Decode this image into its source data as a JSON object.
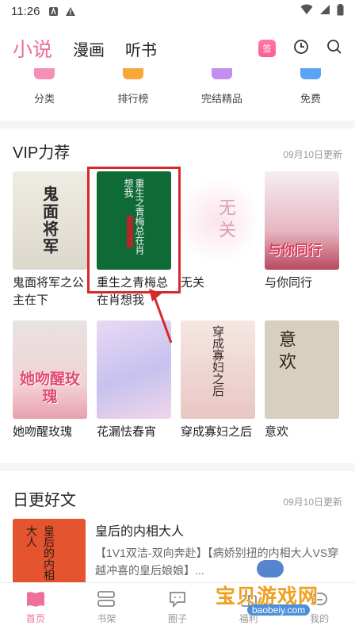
{
  "status": {
    "time": "11:26"
  },
  "nav": {
    "tabs": [
      {
        "label": "小说"
      },
      {
        "label": "漫画"
      },
      {
        "label": "听书"
      }
    ],
    "sign_label": "签"
  },
  "categories": [
    {
      "label": "分类"
    },
    {
      "label": "排行榜"
    },
    {
      "label": "完结精品"
    },
    {
      "label": "免费"
    }
  ],
  "vip": {
    "title": "VIP力荐",
    "updated": "09月10日更新",
    "books": [
      {
        "name": "鬼面将军之公主在下",
        "cover_text": "鬼面将军"
      },
      {
        "name": "重生之青梅总在肖想我",
        "cover_text": "重生之青梅总在肖想我"
      },
      {
        "name": "无关",
        "cover_text": "无关"
      },
      {
        "name": "与你同行",
        "cover_text": "与你同行"
      },
      {
        "name": "她吻醒玫瑰",
        "cover_text": "她吻醒玫瑰"
      },
      {
        "name": "花漏怯春宵",
        "cover_text": ""
      },
      {
        "name": "穿成寡妇之后",
        "cover_text": "穿成寡妇之后"
      },
      {
        "name": "意欢",
        "cover_text": "意欢"
      }
    ]
  },
  "daily": {
    "title": "日更好文",
    "updated": "09月10日更新",
    "book": {
      "title": "皇后的内相大人",
      "desc": "【1V1双洁-双向奔赴】【病娇别扭的内相大人VS穿越冲喜的皇后娘娘】...",
      "cover_text": "皇后的内相大人"
    }
  },
  "bottom_nav": [
    {
      "label": "首页"
    },
    {
      "label": "书架"
    },
    {
      "label": "圈子"
    },
    {
      "label": "福利"
    },
    {
      "label": "我的"
    }
  ],
  "watermark": {
    "title": "宝贝游戏网",
    "url": "baobeiy.com"
  },
  "colors": {
    "accent": "#ee6f9a",
    "highlight": "#d62a2a"
  }
}
